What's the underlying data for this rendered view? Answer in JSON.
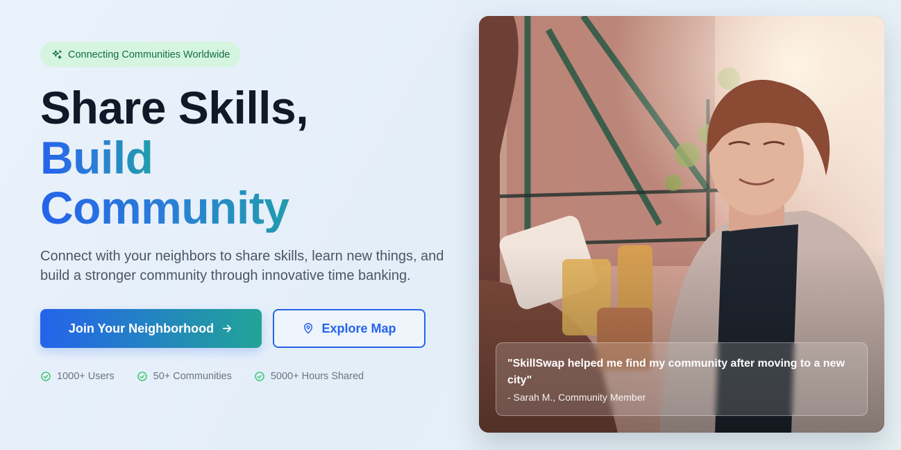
{
  "badge": {
    "label": "Connecting Communities Worldwide",
    "icon": "sparkles-icon"
  },
  "headline": {
    "line1": "Share Skills,",
    "line2": "Build",
    "line3": "Community"
  },
  "description": "Connect with your neighbors to share skills, learn new things, and build a stronger community through innovative time banking.",
  "actions": {
    "primary_label": "Join Your Neighborhood",
    "primary_icon": "arrow-right-icon",
    "secondary_label": "Explore Map",
    "secondary_icon": "map-pin-icon"
  },
  "stats": [
    {
      "label": "1000+ Users",
      "icon": "check-circle-icon"
    },
    {
      "label": "50+ Communities",
      "icon": "check-circle-icon"
    },
    {
      "label": "5000+ Hours Shared",
      "icon": "check-circle-icon"
    }
  ],
  "testimonial": {
    "quote": "\"SkillSwap helped me find my community after moving to a new city\"",
    "author": "- Sarah M., Community Member"
  },
  "colors": {
    "primary_blue": "#2563eb",
    "teal": "#22a497",
    "badge_bg": "#d5f5e1",
    "badge_text": "#146c43",
    "stat_check": "#22c55e"
  }
}
